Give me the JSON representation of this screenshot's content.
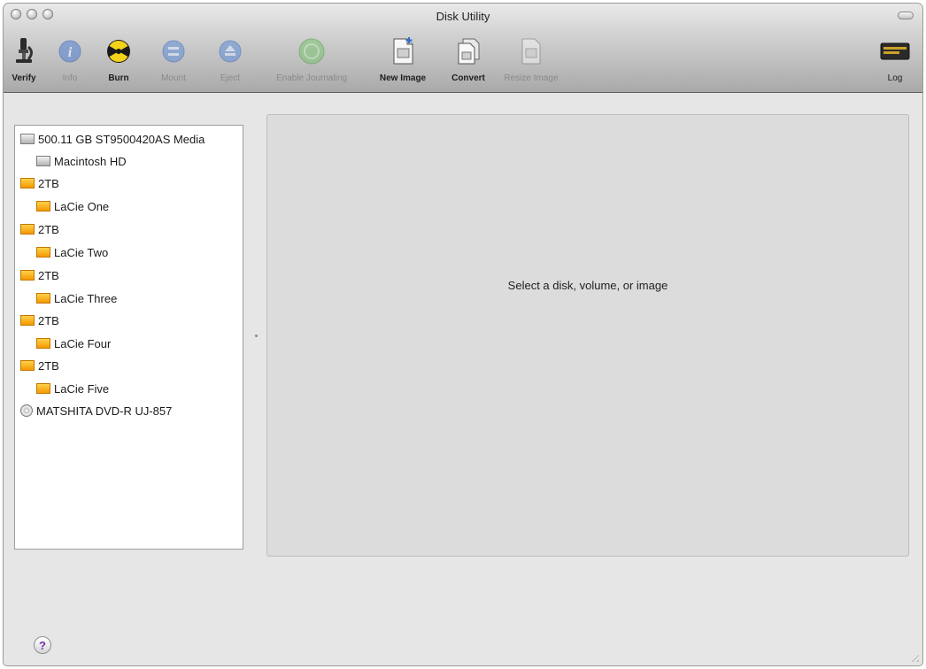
{
  "window": {
    "title": "Disk Utility"
  },
  "toolbar": {
    "items": [
      {
        "id": "verify",
        "label": "Verify",
        "icon": "microscope-icon",
        "enabled": true
      },
      {
        "id": "info",
        "label": "Info",
        "icon": "info-icon",
        "enabled": false
      },
      {
        "id": "burn",
        "label": "Burn",
        "icon": "burn-icon",
        "enabled": true
      },
      {
        "id": "mount",
        "label": "Mount",
        "icon": "mount-icon",
        "enabled": false
      },
      {
        "id": "eject",
        "label": "Eject",
        "icon": "eject-icon",
        "enabled": false
      },
      {
        "id": "enable_journaling",
        "label": "Enable Journaling",
        "icon": "journaling-icon",
        "enabled": false
      },
      {
        "id": "new_image",
        "label": "New Image",
        "icon": "new-image-icon",
        "enabled": true
      },
      {
        "id": "convert",
        "label": "Convert",
        "icon": "convert-icon",
        "enabled": true
      },
      {
        "id": "resize_image",
        "label": "Resize Image",
        "icon": "resize-image-icon",
        "enabled": false
      },
      {
        "id": "log",
        "label": "Log",
        "icon": "log-icon",
        "enabled": true
      }
    ]
  },
  "sidebar": {
    "items": [
      {
        "label": "500.11 GB ST9500420AS Media",
        "level": 0,
        "icon": "hard-disk-icon"
      },
      {
        "label": "Macintosh HD",
        "level": 1,
        "icon": "hard-disk-icon"
      },
      {
        "label": "2TB",
        "level": 0,
        "icon": "external-disk-icon"
      },
      {
        "label": "LaCie One",
        "level": 1,
        "icon": "external-disk-icon"
      },
      {
        "label": "2TB",
        "level": 0,
        "icon": "external-disk-icon"
      },
      {
        "label": "LaCie Two",
        "level": 1,
        "icon": "external-disk-icon"
      },
      {
        "label": "2TB",
        "level": 0,
        "icon": "external-disk-icon"
      },
      {
        "label": "LaCie Three",
        "level": 1,
        "icon": "external-disk-icon"
      },
      {
        "label": "2TB",
        "level": 0,
        "icon": "external-disk-icon"
      },
      {
        "label": "LaCie Four",
        "level": 1,
        "icon": "external-disk-icon"
      },
      {
        "label": "2TB",
        "level": 0,
        "icon": "external-disk-icon"
      },
      {
        "label": "LaCie Five",
        "level": 1,
        "icon": "external-disk-icon"
      },
      {
        "label": "MATSHITA DVD-R UJ-857",
        "level": 0,
        "icon": "optical-disc-icon"
      }
    ]
  },
  "main": {
    "placeholder": "Select a disk, volume, or image"
  },
  "footer": {
    "help_label": "?"
  },
  "colors": {
    "accent_orange": "#f59a00",
    "help_purple": "#7a2fb0"
  }
}
